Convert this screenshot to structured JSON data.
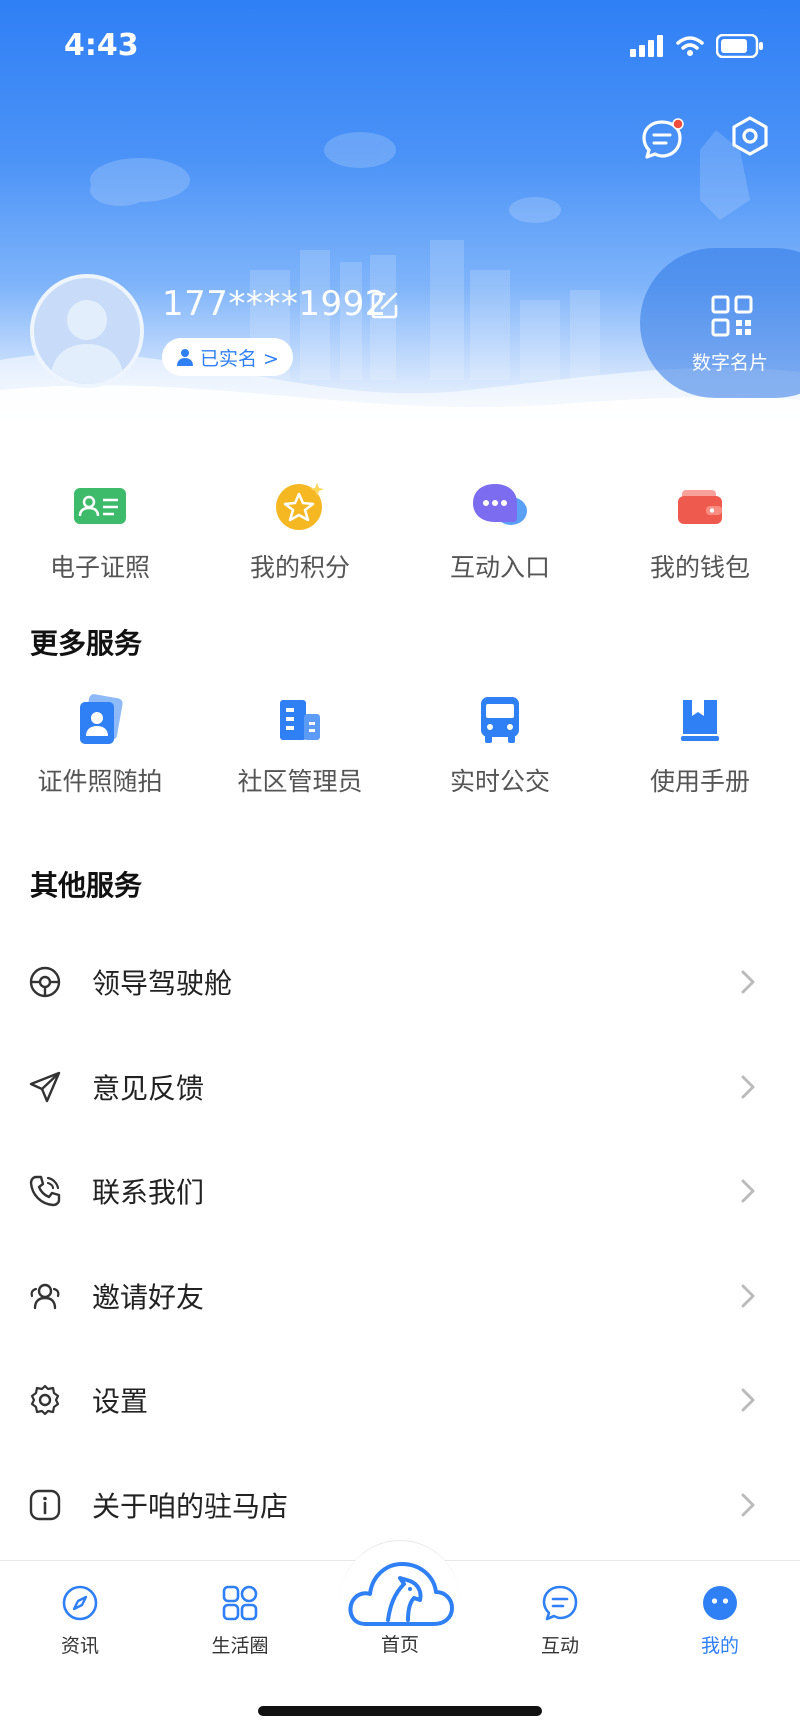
{
  "status": {
    "time": "4:43"
  },
  "profile": {
    "phone": "177****1992",
    "verified_label": "已实名 >",
    "digital_card_label": "数字名片"
  },
  "quick": [
    {
      "label": "电子证照",
      "icon": "id-card-icon",
      "color": "#3dbb6a"
    },
    {
      "label": "我的积分",
      "icon": "points-star-icon",
      "color": "#f5b823"
    },
    {
      "label": "互动入口",
      "icon": "chat-bubble-icon",
      "color": "#7b6cf0"
    },
    {
      "label": "我的钱包",
      "icon": "wallet-icon",
      "color": "#ef5a4e"
    }
  ],
  "more_services": {
    "title": "更多服务",
    "items": [
      {
        "label": "证件照随拍",
        "icon": "photo-id-icon"
      },
      {
        "label": "社区管理员",
        "icon": "building-icon"
      },
      {
        "label": "实时公交",
        "icon": "bus-icon"
      },
      {
        "label": "使用手册",
        "icon": "manual-book-icon"
      }
    ]
  },
  "other_services": {
    "title": "其他服务",
    "items": [
      {
        "label": "领导驾驶舱",
        "icon": "cockpit-icon"
      },
      {
        "label": "意见反馈",
        "icon": "send-plane-icon"
      },
      {
        "label": "联系我们",
        "icon": "phone-icon"
      },
      {
        "label": "邀请好友",
        "icon": "friends-icon"
      },
      {
        "label": "设置",
        "icon": "gear-icon"
      },
      {
        "label": "关于咱的驻马店",
        "icon": "info-icon"
      }
    ]
  },
  "tabs": [
    {
      "label": "资讯",
      "icon": "compass-icon"
    },
    {
      "label": "生活圈",
      "icon": "apps-grid-icon"
    },
    {
      "label": "首页",
      "icon": "horse-cloud-icon"
    },
    {
      "label": "互动",
      "icon": "message-icon"
    },
    {
      "label": "我的",
      "icon": "profile-face-icon",
      "active": true
    }
  ],
  "colors": {
    "primary": "#2f7ff5",
    "text": "#222222",
    "muted": "#555555"
  }
}
